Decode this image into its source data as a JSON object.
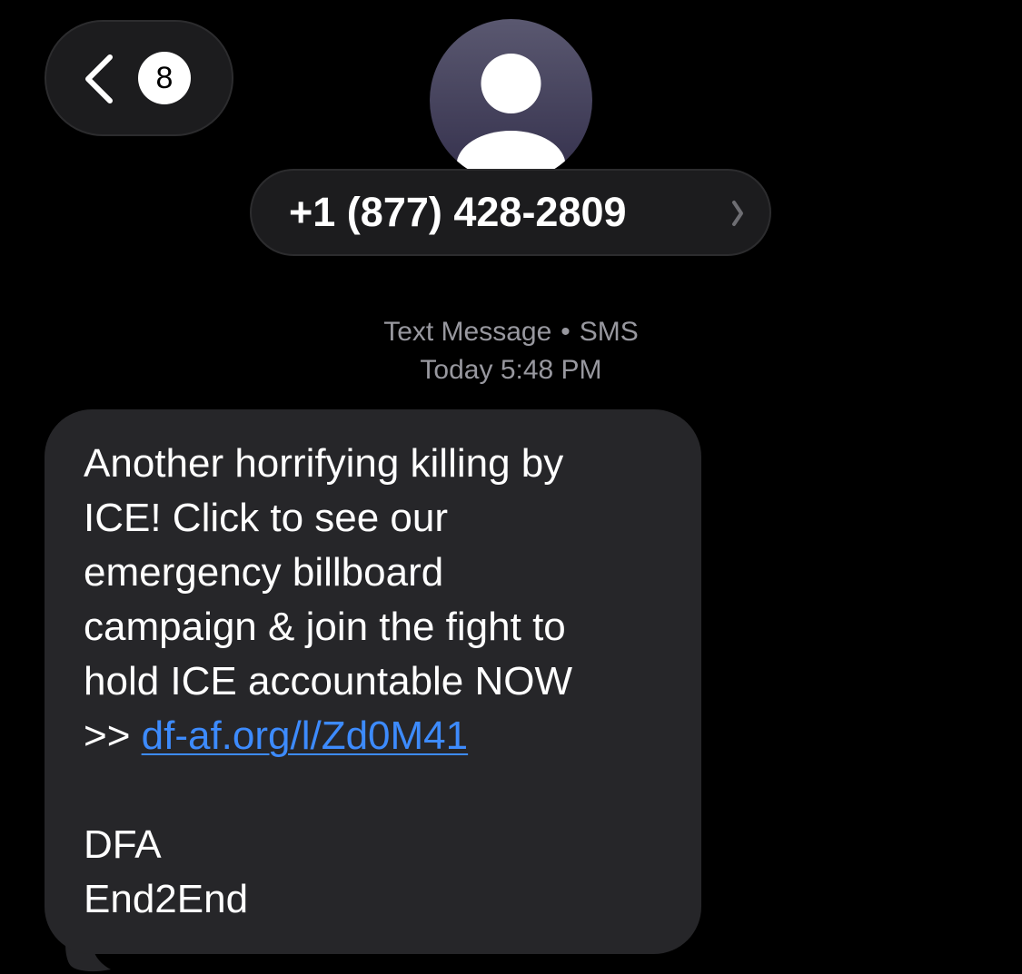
{
  "header": {
    "back": {
      "icon": "chevron-left-icon",
      "unread_count": "8"
    },
    "contact": {
      "avatar_icon": "person-silhouette-icon",
      "number": "+1 (877) 428-2809",
      "chevron_icon": "chevron-right-icon"
    }
  },
  "thread_meta": {
    "service": "Text Message",
    "separator": "•",
    "protocol": "SMS",
    "day": "Today",
    "time": "5:48 PM"
  },
  "message": {
    "direction": "incoming",
    "lines": [
      "Another horrifying killing by",
      "ICE! Click to see our",
      "emergency billboard",
      "campaign & join the fight to",
      "hold ICE accountable NOW"
    ],
    "link_prefix": ">> ",
    "link_text": "df-af.org/l/Zd0M41",
    "signature_lines": [
      "DFA",
      "End2End"
    ]
  },
  "colors": {
    "background": "#000000",
    "bubble": "#262629",
    "pill": "#1c1c1e",
    "meta_text": "#98989f",
    "link": "#3d8bfd",
    "avatar_gradient_top": "#5a5870",
    "avatar_gradient_bottom": "#34304c"
  }
}
